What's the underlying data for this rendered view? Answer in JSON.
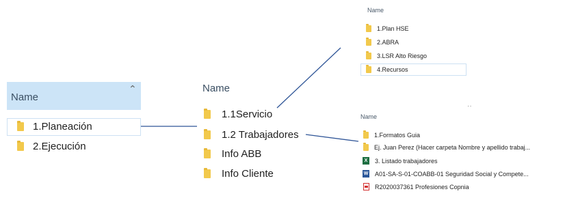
{
  "panel1": {
    "header": "Name",
    "items": [
      "1.Planeación",
      "2.Ejecución"
    ]
  },
  "panel2": {
    "header": "Name",
    "items": [
      "1.1Servicio",
      "1.2 Trabajadores",
      "Info ABB",
      "Info Cliente"
    ]
  },
  "panel3": {
    "header": "Name",
    "items": [
      "1.Plan HSE",
      "2.ABRA",
      "3.LSR Alto Riesgo",
      "4.Recursos"
    ]
  },
  "panel4": {
    "header": "Name",
    "items": [
      {
        "icon": "folder-icon",
        "label": "1.Formatos Guia"
      },
      {
        "icon": "folder-icon",
        "label": "Ej. Juan Perez (Hacer carpeta Nombre y apellido trabaj..."
      },
      {
        "icon": "excel-file-icon",
        "label": "3. Listado trabajadores"
      },
      {
        "icon": "word-file-icon",
        "label": "A01-SA-S-01-COABB-01 Seguridad Social y Compete..."
      },
      {
        "icon": "pdf-file-icon",
        "label": "R2020037361 Profesiones Copnia"
      }
    ]
  },
  "colors": {
    "header_bg": "#cce4f7",
    "folder": "#f2c94c",
    "connector": "#2f5597"
  }
}
